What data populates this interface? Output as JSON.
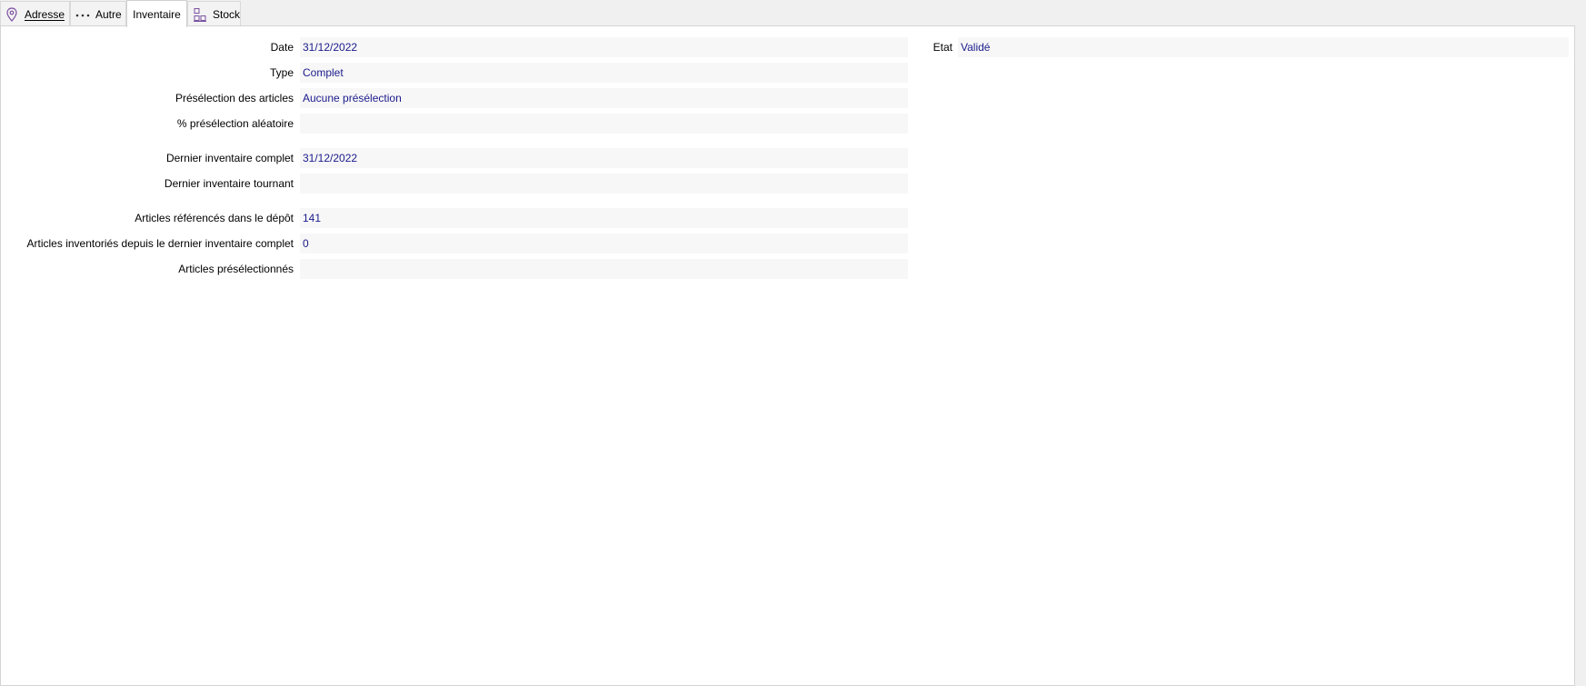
{
  "tabs": [
    {
      "label": "Adresse",
      "mnemonic": "A",
      "icon": "map-pin-icon"
    },
    {
      "label": "Autre",
      "mnemonic": "u",
      "icon": "ellipsis-icon"
    },
    {
      "label": "Inventaire",
      "active": true
    },
    {
      "label": "Stock",
      "mnemonic": "S",
      "icon": "warehouse-grid-icon"
    }
  ],
  "form": {
    "date": {
      "label": "Date",
      "value": "31/12/2022"
    },
    "type": {
      "label": "Type",
      "value": "Complet"
    },
    "preselection": {
      "label": "Présélection des articles",
      "value": "Aucune présélection"
    },
    "random_pct": {
      "label": "% présélection aléatoire",
      "value": ""
    },
    "last_full": {
      "label": "Dernier inventaire complet",
      "value": "31/12/2022"
    },
    "last_rolling": {
      "label": "Dernier inventaire tournant",
      "value": ""
    },
    "referenced": {
      "label": "Articles référencés dans le dépôt",
      "value": "141"
    },
    "inventoried": {
      "label": "Articles inventoriés depuis le dernier inventaire complet",
      "value": "0"
    },
    "preselected": {
      "label": "Articles présélectionnés",
      "value": ""
    },
    "etat": {
      "label": "Etat",
      "value": "Validé"
    }
  },
  "colors": {
    "value_text": "#1b1b8c",
    "icon_purple": "#7a4fa0",
    "field_bg": "#f7f7f7"
  }
}
